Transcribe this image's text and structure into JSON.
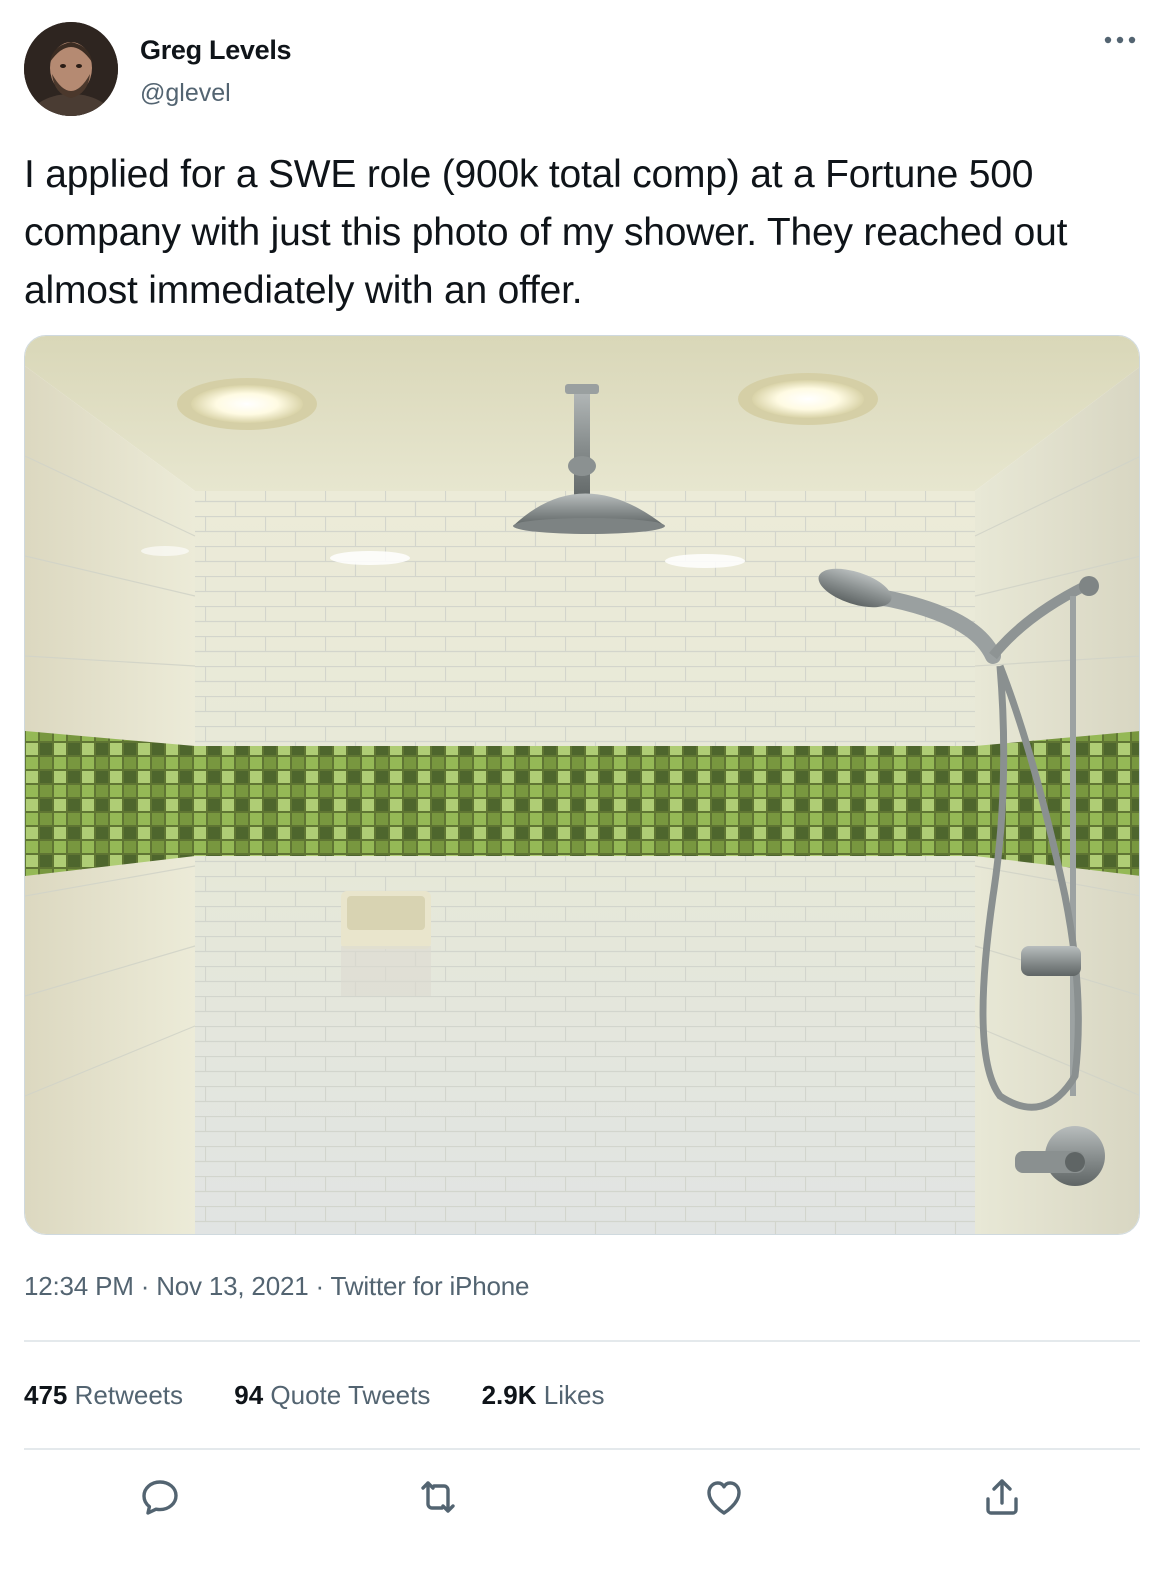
{
  "user": {
    "display_name": "Greg Levels",
    "handle": "@glevel"
  },
  "tweet": {
    "text": "I applied for a SWE role (900k total comp) at a Fortune 500 company with just this photo of my shower. They reached out almost immediately with an offer.",
    "time": "12:34 PM",
    "date": "Nov 13, 2021",
    "source": "Twitter for iPhone"
  },
  "stats": {
    "retweets_count": "475",
    "retweets_label": "Retweets",
    "quotes_count": "94",
    "quotes_label": "Quote Tweets",
    "likes_count": "2.9K",
    "likes_label": "Likes"
  },
  "meta_separator": " · ",
  "icons": {
    "more": "more-horizontal-icon",
    "reply": "reply-icon",
    "retweet": "retweet-icon",
    "like": "heart-icon",
    "share": "share-icon"
  },
  "colors": {
    "text_primary": "#0f1419",
    "text_secondary": "#536471",
    "divider": "#e4e9ec",
    "tile_green": "#7aa23a"
  }
}
